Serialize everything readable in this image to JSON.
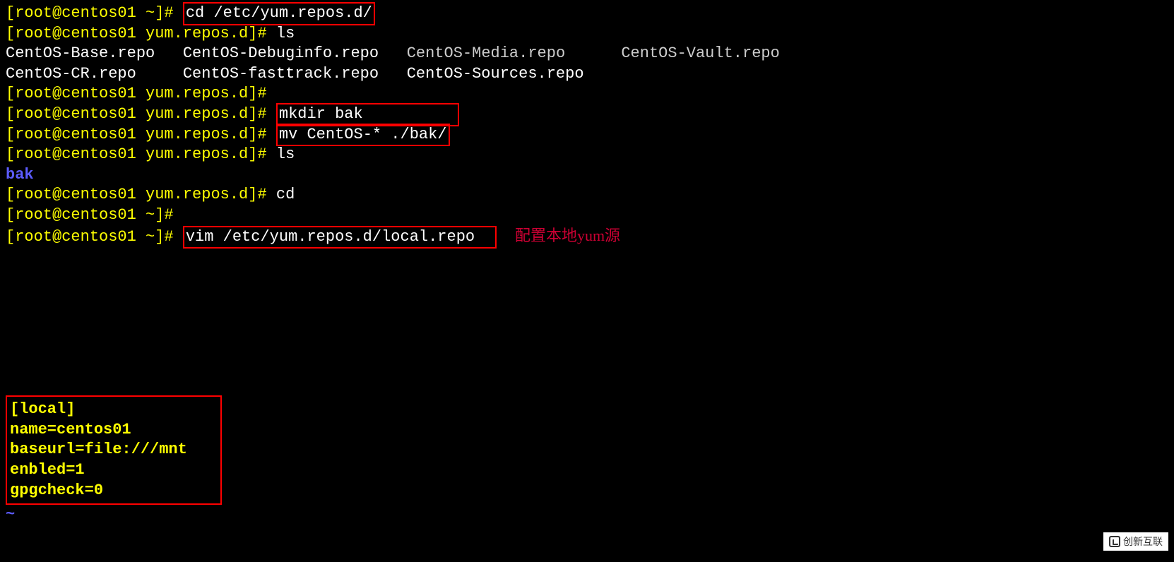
{
  "prompt_home": "[root@centos01 ~]#",
  "prompt_repos": "[root@centos01 yum.repos.d]#",
  "cmd1": "cd /etc/yum.repos.d/",
  "cmd2": "ls",
  "ls1_left": "CentOS-Base.repo   CentOS-Debuginfo.repo   ",
  "ls1_media": "CentOS-Media.repo",
  "ls1_spacer": "      ",
  "ls1_vault": "CentOS-Vault.repo",
  "ls1_right": "CentOS-CR.repo     CentOS-fasttrack.repo   CentOS-Sources.repo",
  "cmd3": "mkdir bak",
  "cmd4": "mv CentOS-* ./bak/",
  "cmd5": "ls",
  "ls2": "bak",
  "cmd6": "cd",
  "cmd7": "vim /etc/yum.repos.d/local.repo",
  "annotation": "配置本地yum源",
  "repo": {
    "l1": "[local]",
    "l2": "name=centos01",
    "l3": "baseurl=file:///mnt",
    "l4": "enbled=1",
    "l5": "gpgcheck=0"
  },
  "tilde": "~",
  "watermark": "创新互联"
}
